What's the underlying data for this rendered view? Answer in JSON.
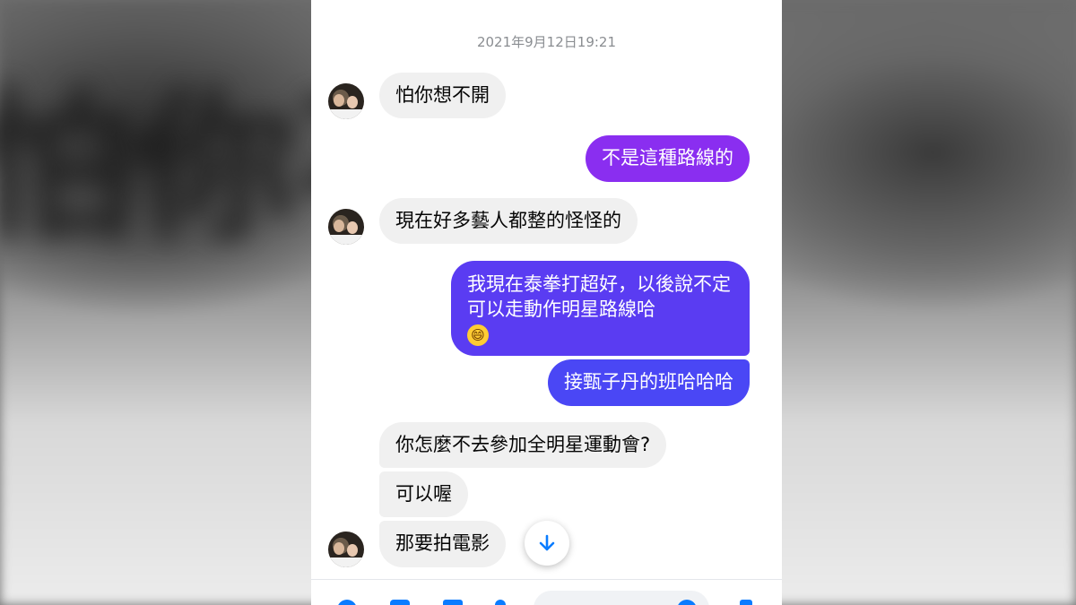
{
  "background_text": "怕你不開",
  "conversation": {
    "timestamp": "2021年9月12日19:21",
    "messages": [
      {
        "from": "other",
        "text": "怕你想不開"
      },
      {
        "from": "me",
        "text": "不是這種路線的"
      },
      {
        "from": "other",
        "text": "現在好多藝人都整的怪怪的"
      },
      {
        "from": "me",
        "text": "我現在泰拳打超好，以後說不定可以走動作明星路線哈"
      },
      {
        "from": "me",
        "text": "接甄子丹的班哈哈哈"
      },
      {
        "from": "other",
        "text": "你怎麼不去參加全明星運動會?"
      },
      {
        "from": "other",
        "text": "可以喔"
      },
      {
        "from": "other",
        "text": "那要拍電影"
      }
    ]
  },
  "emoji": "😄",
  "colors": {
    "sent_top": "#8a2ef0",
    "sent_mid": "#5a3cf2",
    "sent_bottom": "#4a47f5",
    "received": "#f0f0f0",
    "accent": "#0a7cff"
  },
  "icons": [
    "avatar",
    "arrow-down-icon",
    "camera-icon",
    "image-icon",
    "mic-icon",
    "emoji-icon",
    "send-icon"
  ]
}
